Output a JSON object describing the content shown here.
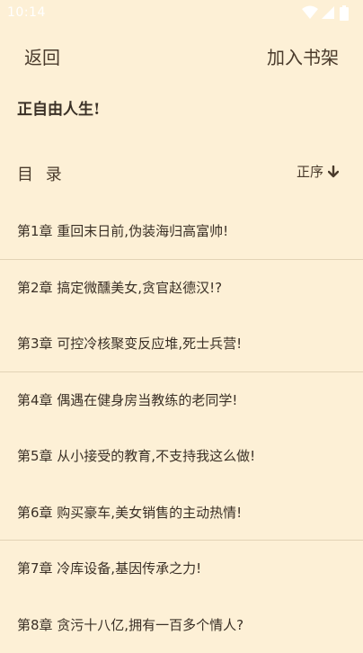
{
  "status_bar": {
    "time": "10:14",
    "icons": [
      "wifi-icon",
      "cellular-signal-icon",
      "battery-icon"
    ]
  },
  "topbar": {
    "back_label": "返回",
    "add_shelf_label": "加入书架"
  },
  "book": {
    "title": "正自由人生!"
  },
  "toc": {
    "title": "目 录",
    "sort_label": "正序",
    "sort_icon": "arrow-down-icon"
  },
  "chapters": [
    {
      "label": "第1章 重回末日前,伪装海归高富帅!"
    },
    {
      "label": "第2章 搞定微醺美女,贪官赵德汉!?"
    },
    {
      "label": "第3章 可控冷核聚变反应堆,死士兵营!"
    },
    {
      "label": "第4章 偶遇在健身房当教练的老同学!"
    },
    {
      "label": "第5章 从小接受的教育,不支持我这么做!"
    },
    {
      "label": "第6章 购买豪车,美女销售的主动热情!"
    },
    {
      "label": "第7章 冷库设备,基因传承之力!"
    },
    {
      "label": "第8章 贪污十八亿,拥有一百多个情人?"
    }
  ],
  "colors": {
    "background": "#fdf0d6",
    "text": "#3a3026",
    "divider": "#e2d3b6"
  }
}
